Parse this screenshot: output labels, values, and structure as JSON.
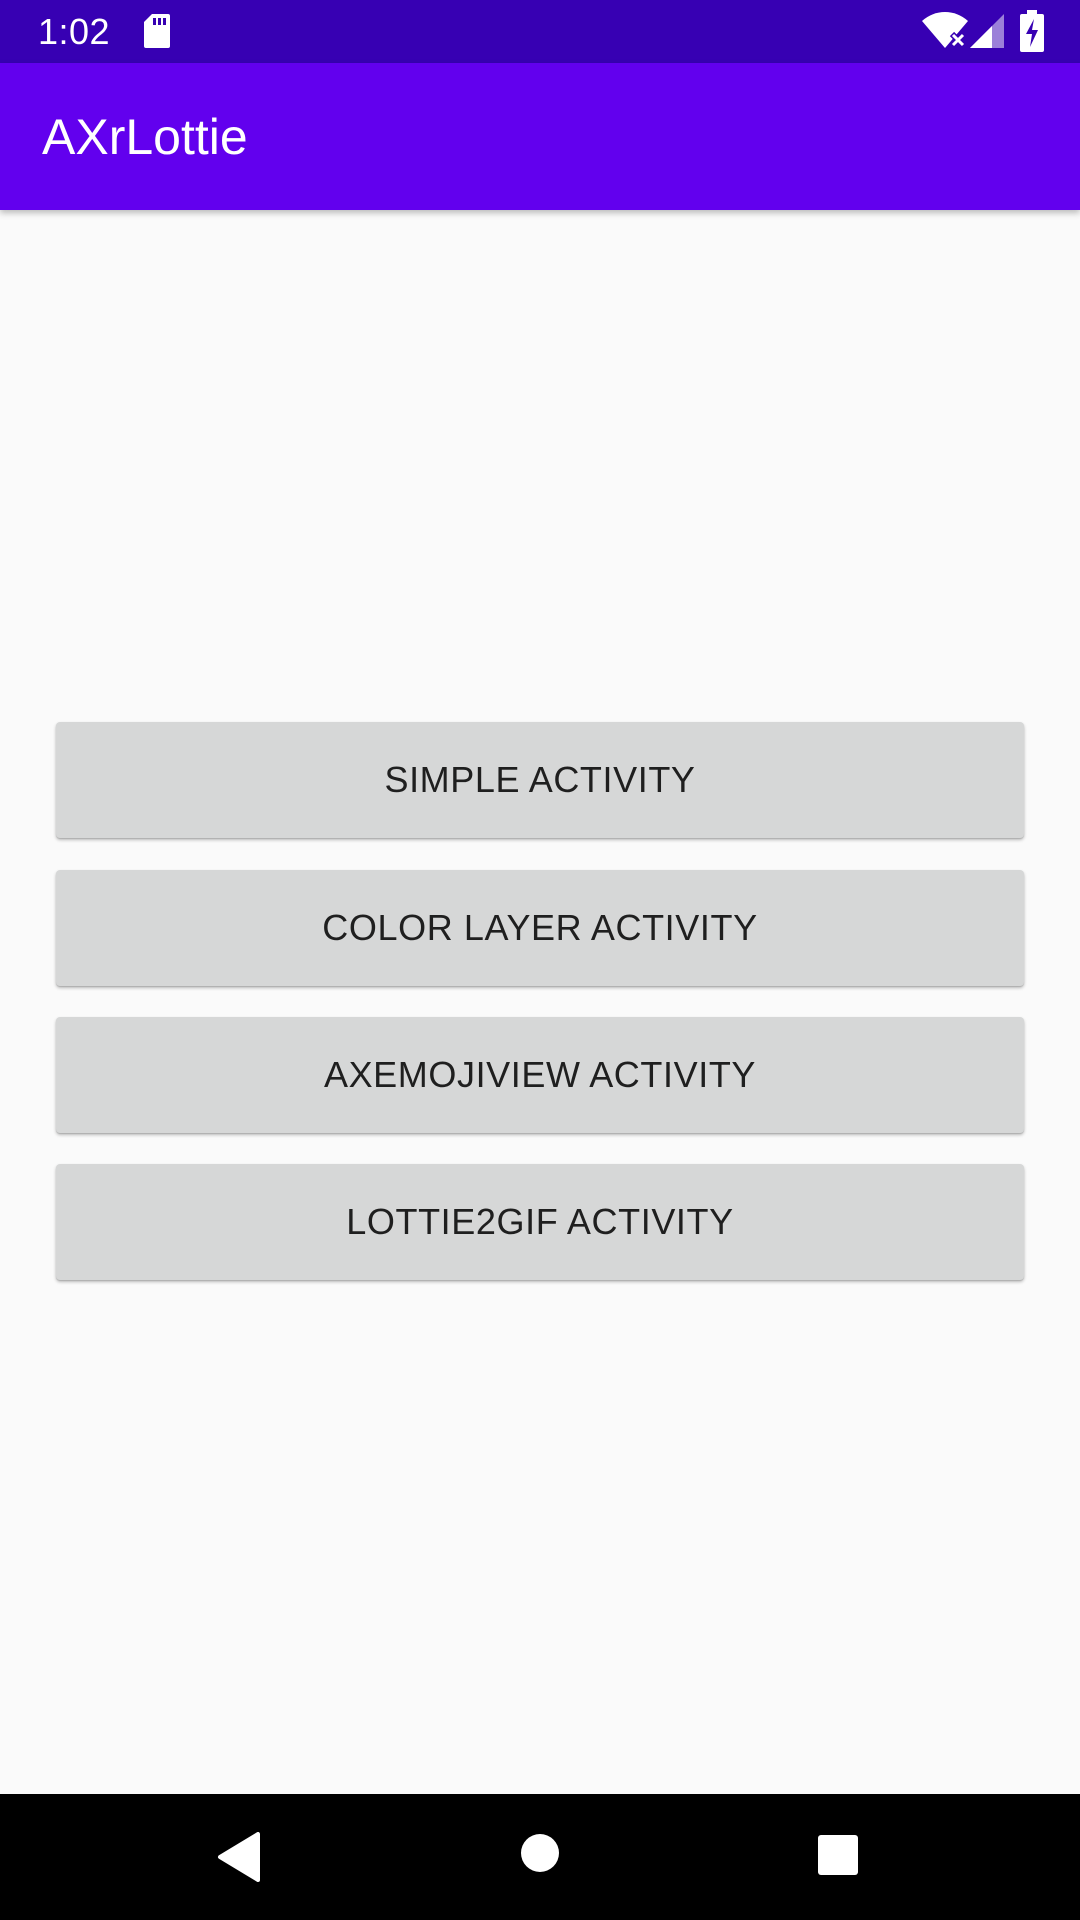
{
  "status_bar": {
    "time": "1:02",
    "icons": [
      "sd-card-icon",
      "wifi-icon",
      "signal-icon",
      "battery-charging-icon"
    ]
  },
  "app_bar": {
    "title": "AXrLottie",
    "color": "#6200ee"
  },
  "buttons": [
    {
      "label": "SIMPLE ACTIVITY"
    },
    {
      "label": "COLOR LAYER ACTIVITY"
    },
    {
      "label": "AXEMOJIVIEW ACTIVITY"
    },
    {
      "label": "LOTTIE2GIF ACTIVITY"
    }
  ],
  "nav_bar": {
    "icons": [
      "back-icon",
      "home-icon",
      "recents-icon"
    ]
  },
  "colors": {
    "status_bar": "#3700b3",
    "app_bar": "#6200ee",
    "button_bg": "#d6d7d7",
    "background": "#fafafa"
  }
}
